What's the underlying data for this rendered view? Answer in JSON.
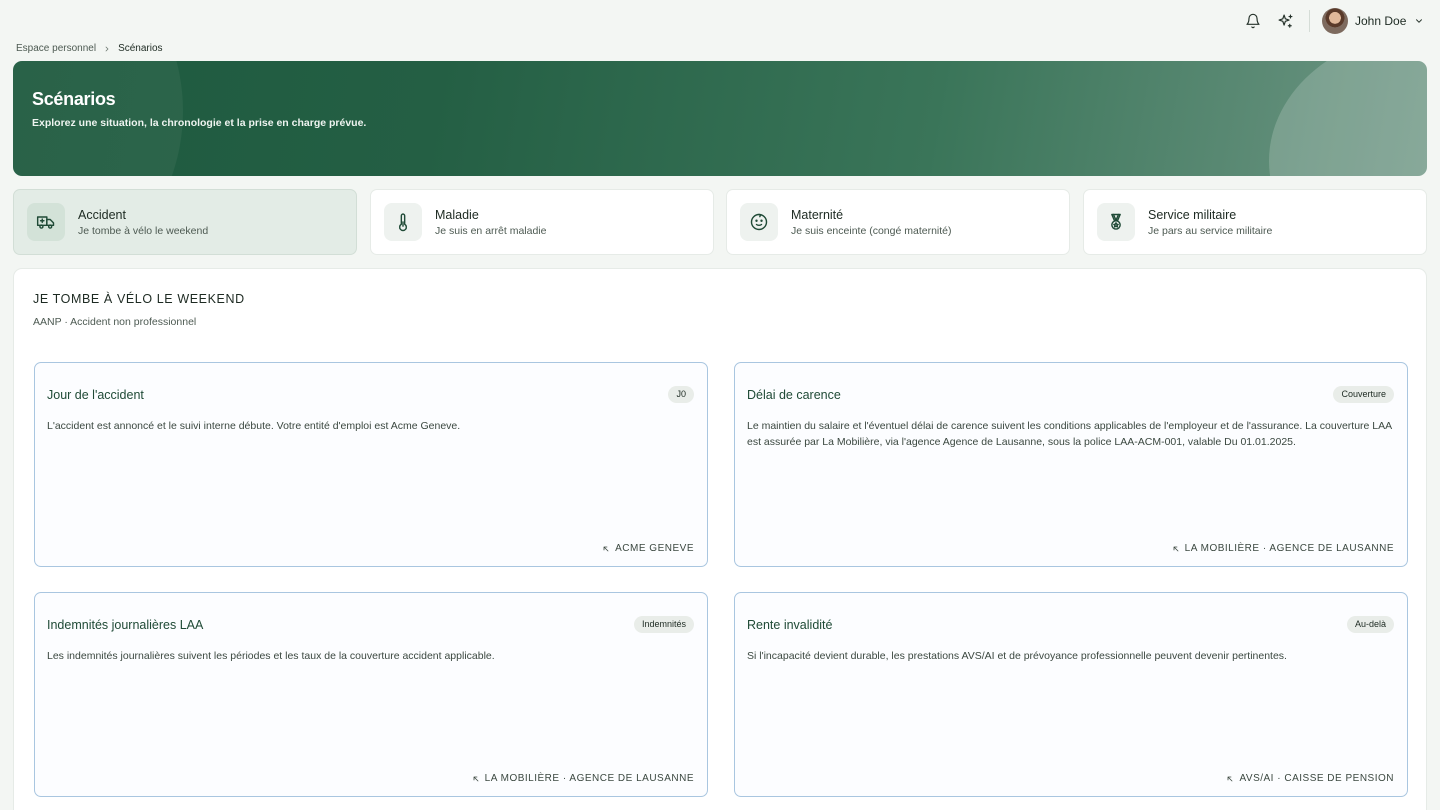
{
  "topbar": {
    "icons": [
      "bell-icon",
      "sparkles-icon"
    ],
    "user": {
      "name": "John Doe"
    }
  },
  "breadcrumb": {
    "items": [
      "Espace personnel",
      "Scénarios"
    ]
  },
  "hero": {
    "title": "Scénarios",
    "subtitle": "Explorez une situation, la chronologie et la prise en charge prévue."
  },
  "tabs": [
    {
      "title": "Accident",
      "subtitle": "Je tombe à vélo le weekend",
      "icon": "ambulance-icon",
      "active": true
    },
    {
      "title": "Maladie",
      "subtitle": "Je suis en arrêt maladie",
      "icon": "thermometer-icon",
      "active": false
    },
    {
      "title": "Maternité",
      "subtitle": "Je suis enceinte (congé maternité)",
      "icon": "baby-icon",
      "active": false
    },
    {
      "title": "Service militaire",
      "subtitle": "Je pars au service militaire",
      "icon": "medal-icon",
      "active": false
    }
  ],
  "panel": {
    "title": "JE TOMBE À VÉLO LE WEEKEND",
    "subtitle": "AANP · Accident non professionnel",
    "cards": [
      {
        "title": "Jour de l'accident",
        "badge": "J0",
        "body": "L'accident est annoncé et le suivi interne débute. Votre entité d'emploi est Acme Geneve.",
        "footer": "ACME GENEVE"
      },
      {
        "title": "Délai de carence",
        "badge": "Couverture",
        "body": "Le maintien du salaire et l'éventuel délai de carence suivent les conditions applicables de l'employeur et de l'assurance. La couverture LAA est assurée par La Mobilière, via l'agence Agence de Lausanne, sous la police LAA-ACM-001, valable Du 01.01.2025.",
        "footer": "LA MOBILIÈRE · AGENCE DE LAUSANNE"
      },
      {
        "title": "Indemnités journalières LAA",
        "badge": "Indemnités",
        "body": "Les indemnités journalières suivent les périodes et les taux de la couverture accident applicable.",
        "footer": "LA MOBILIÈRE · AGENCE DE LAUSANNE"
      },
      {
        "title": "Rente invalidité",
        "badge": "Au-delà",
        "body": "Si l'incapacité devient durable, les prestations AVS/AI et de prévoyance professionnelle peuvent devenir pertinentes.",
        "footer": "AVS/AI · CAISSE DE PENSION"
      }
    ]
  },
  "colors": {
    "brand_green": "#1e5a3f",
    "card_border": "#a9c6e0",
    "active_tab_bg": "#e3ece6"
  }
}
